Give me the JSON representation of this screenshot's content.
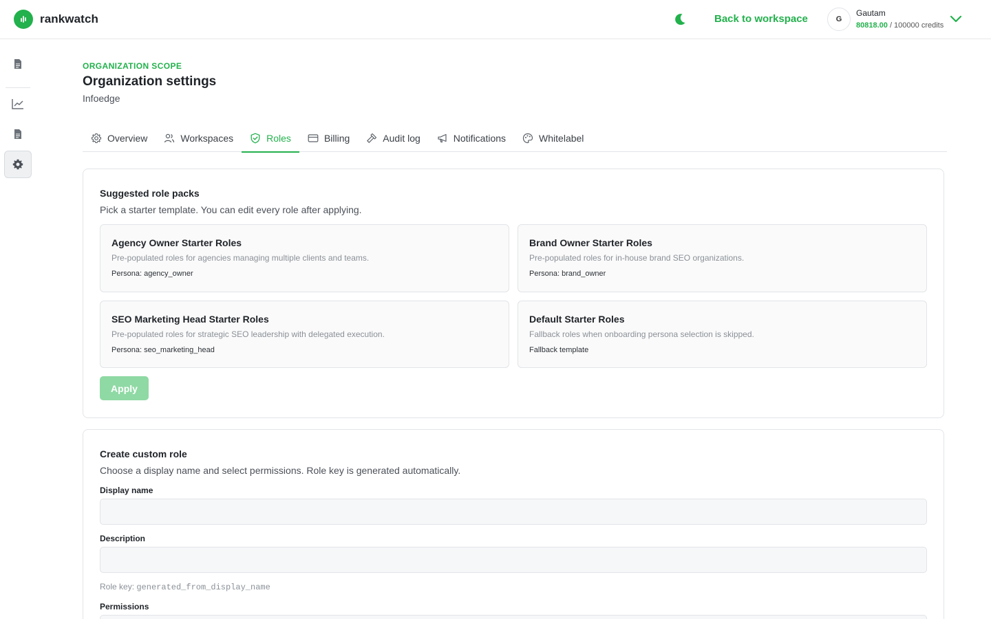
{
  "brand": {
    "name": "rankwatch"
  },
  "topbar": {
    "back_link": "Back to workspace",
    "user": {
      "initial": "G",
      "name": "Gautam",
      "credits_used": "80818.00",
      "credits_total": " / 100000 credits"
    }
  },
  "header": {
    "eyebrow": "ORGANIZATION SCOPE",
    "title": "Organization settings",
    "org": "Infoedge"
  },
  "tabs": [
    {
      "label": "Overview",
      "icon": "gear-icon"
    },
    {
      "label": "Workspaces",
      "icon": "users-icon"
    },
    {
      "label": "Roles",
      "icon": "shield-check-icon",
      "active": true
    },
    {
      "label": "Billing",
      "icon": "credit-card-icon"
    },
    {
      "label": "Audit log",
      "icon": "hammer-icon"
    },
    {
      "label": "Notifications",
      "icon": "megaphone-icon"
    },
    {
      "label": "Whitelabel",
      "icon": "palette-icon"
    }
  ],
  "role_packs": {
    "title": "Suggested role packs",
    "subtitle": "Pick a starter template. You can edit every role after applying.",
    "packs": [
      {
        "title": "Agency Owner Starter Roles",
        "desc": "Pre-populated roles for agencies managing multiple clients and teams.",
        "persona": "Persona: agency_owner"
      },
      {
        "title": "Brand Owner Starter Roles",
        "desc": "Pre-populated roles for in-house brand SEO organizations.",
        "persona": "Persona: brand_owner"
      },
      {
        "title": "SEO Marketing Head Starter Roles",
        "desc": "Pre-populated roles for strategic SEO leadership with delegated execution.",
        "persona": "Persona: seo_marketing_head"
      },
      {
        "title": "Default Starter Roles",
        "desc": "Fallback roles when onboarding persona selection is skipped.",
        "persona": "Fallback template"
      }
    ],
    "apply_label": "Apply"
  },
  "custom_role": {
    "title": "Create custom role",
    "subtitle": "Choose a display name and select permissions. Role key is generated automatically.",
    "display_name_label": "Display name",
    "display_name_value": "",
    "description_label": "Description",
    "description_value": "",
    "role_key_label": "Role key: ",
    "role_key_value": "generated_from_display_name",
    "permissions_label": "Permissions"
  },
  "colors": {
    "accent": "#22b14c",
    "accent_disabled": "#8fd9a4",
    "border": "#e1e4e8"
  }
}
